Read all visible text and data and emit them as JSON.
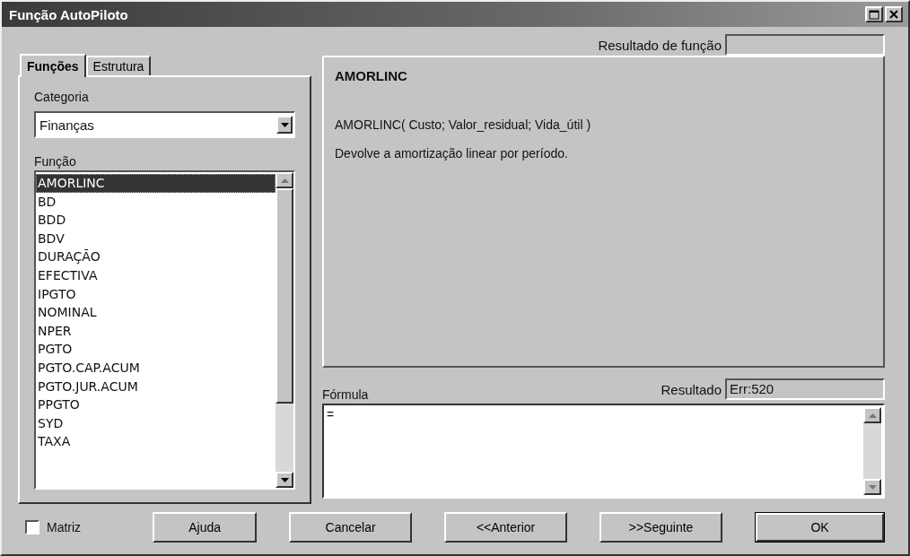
{
  "window": {
    "title": "Função AutoPiloto"
  },
  "tabs": [
    {
      "label": "Funções",
      "selected": true
    },
    {
      "label": "Estrutura",
      "selected": false
    }
  ],
  "category": {
    "label": "Categoria",
    "value": "Finanças"
  },
  "function_list": {
    "label": "Função",
    "items": [
      {
        "name": "AMORLINC",
        "selected": true
      },
      {
        "name": "BD",
        "selected": false
      },
      {
        "name": "BDD",
        "selected": false
      },
      {
        "name": "BDV",
        "selected": false
      },
      {
        "name": "DURAÇÃO",
        "selected": false
      },
      {
        "name": "EFECTIVA",
        "selected": false
      },
      {
        "name": "IPGTO",
        "selected": false
      },
      {
        "name": "NOMINAL",
        "selected": false
      },
      {
        "name": "NPER",
        "selected": false
      },
      {
        "name": "PGTO",
        "selected": false
      },
      {
        "name": "PGTO.CAP.ACUM",
        "selected": false
      },
      {
        "name": "PGTO.JUR.ACUM",
        "selected": false
      },
      {
        "name": "PPGTO",
        "selected": false
      },
      {
        "name": "SYD",
        "selected": false
      },
      {
        "name": "TAXA",
        "selected": false
      }
    ]
  },
  "function_result": {
    "label": "Resultado de função"
  },
  "description": {
    "name": "AMORLINC",
    "syntax": "AMORLINC( Custo; Valor_residual; Vida_útil )",
    "text": "Devolve a amortização linear por período."
  },
  "formula": {
    "label": "Fórmula",
    "value": "=",
    "result_label": "Resultado",
    "result": "Err:520"
  },
  "matrix": {
    "label": "Matriz",
    "checked": false
  },
  "buttons": [
    {
      "label": "Ajuda",
      "default": false
    },
    {
      "label": "Cancelar",
      "default": false
    },
    {
      "label": "<<Anterior",
      "default": false
    },
    {
      "label": ">>Seguinte",
      "default": false
    },
    {
      "label": "OK",
      "default": true
    }
  ]
}
